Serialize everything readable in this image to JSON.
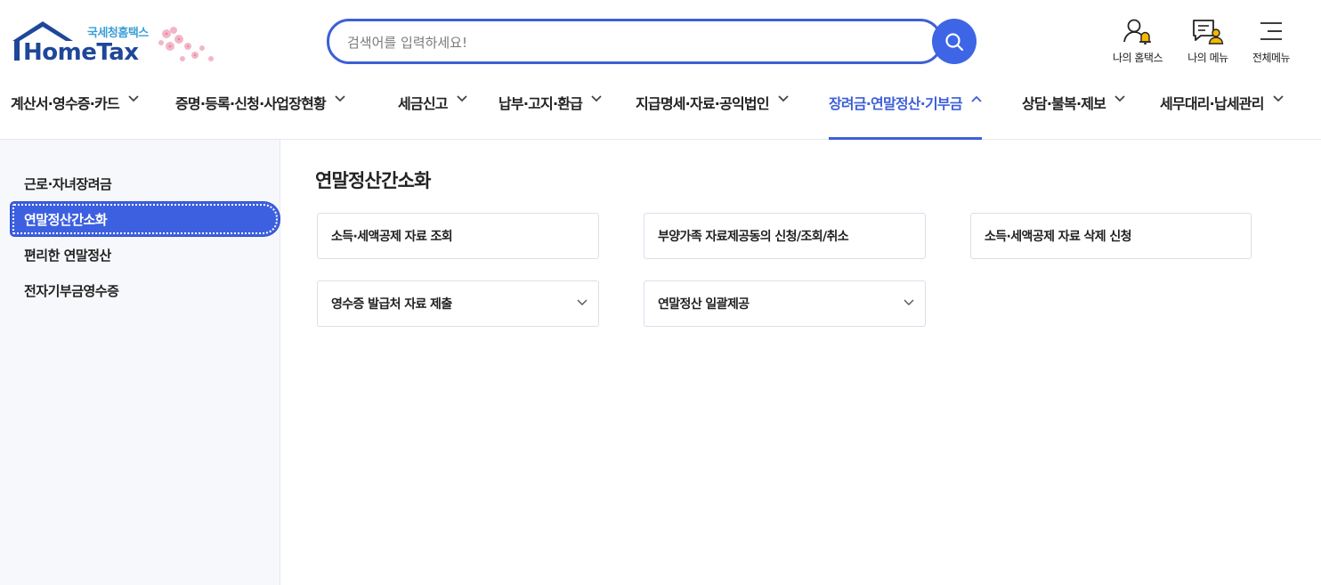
{
  "logo": {
    "korean_name": "국세청홈택스",
    "brand": "HomeTax"
  },
  "search": {
    "placeholder": "검색어를 입력하세요!",
    "value": ""
  },
  "utility": [
    {
      "label": "나의 홈택스",
      "icon": "user-bell-icon"
    },
    {
      "label": "나의 메뉴",
      "icon": "my-menu-icon"
    },
    {
      "label": "전체메뉴",
      "icon": "hamburger-menu-icon"
    }
  ],
  "gnb": [
    {
      "label": "계산서·영수증·카드",
      "expanded": false
    },
    {
      "label": "증명·등록·신청·사업장현황",
      "expanded": false
    },
    {
      "label": "세금신고",
      "expanded": false
    },
    {
      "label": "납부·고지·환급",
      "expanded": false
    },
    {
      "label": "지급명세·자료·공익법인",
      "expanded": false
    },
    {
      "label": "장려금·연말정산·기부금",
      "expanded": true
    },
    {
      "label": "상담·불복·제보",
      "expanded": false
    },
    {
      "label": "세무대리·납세관리",
      "expanded": false
    }
  ],
  "sidebar": {
    "items": [
      {
        "label": "근로·자녀장려금"
      },
      {
        "label": "연말정산간소화",
        "active": true
      },
      {
        "label": "편리한 연말정산"
      },
      {
        "label": "전자기부금영수증"
      }
    ]
  },
  "main": {
    "title": "연말정산간소화",
    "cards": [
      {
        "label": "소득·세액공제 자료 조회",
        "has_dropdown": false
      },
      {
        "label": "부양가족 자료제공동의 신청/조회/취소",
        "has_dropdown": false
      },
      {
        "label": "소득·세액공제 자료 삭제 신청",
        "has_dropdown": false
      },
      {
        "label": "영수증 발급처 자료 제출",
        "has_dropdown": true
      },
      {
        "label": "연말정산 일괄제공",
        "has_dropdown": true
      }
    ]
  },
  "colors": {
    "accent": "#3d5fd9",
    "brand_navy": "#1f4799",
    "brand_sky": "#3a9fd6",
    "sidebar_bg": "#f7f8fb"
  }
}
